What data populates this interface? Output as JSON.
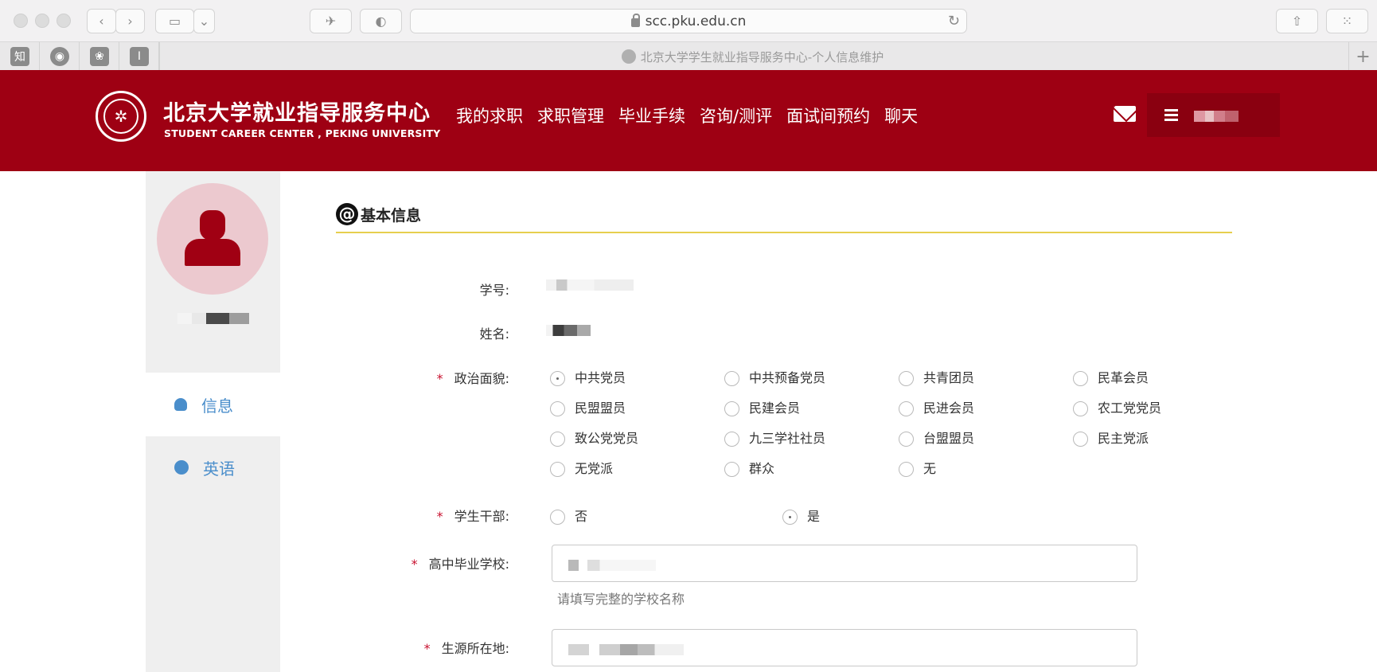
{
  "browser": {
    "url": "scc.pku.edu.cn",
    "tab_title": "北京大学学生就业指导服务中心-个人信息维护",
    "favorites": [
      {
        "label": "知",
        "icon": "zhihu-icon"
      },
      {
        "label": "",
        "icon": "location-pin-icon"
      },
      {
        "label": "",
        "icon": "paw-icon"
      },
      {
        "label": "I",
        "icon": "bookmark-icon"
      }
    ]
  },
  "header": {
    "logo_cn": "北京大学就业指导服务中心",
    "logo_en": "STUDENT CAREER CENTER , PEKING UNIVERSITY",
    "nav": [
      "我的求职",
      "求职管理",
      "毕业手续",
      "咨询/测评",
      "面试间预约",
      "聊天"
    ],
    "brand_color": "#9e0013"
  },
  "sidebar": {
    "items": [
      {
        "label": "信息",
        "icon": "user-icon"
      },
      {
        "label": "英语",
        "icon": "globe-icon"
      }
    ]
  },
  "form": {
    "section_title": "基本信息",
    "student_id_label": "学号:",
    "name_label": "姓名:",
    "political_label": "政治面貌:",
    "political_options": [
      "中共党员",
      "中共预备党员",
      "共青团员",
      "民革会员",
      "民盟盟员",
      "民建会员",
      "民进会员",
      "农工党党员",
      "致公党党员",
      "九三学社社员",
      "台盟盟员",
      "民主党派",
      "无党派",
      "群众",
      "无"
    ],
    "political_selected": "中共党员",
    "cadre_label": "学生干部:",
    "cadre_options": [
      "否",
      "是"
    ],
    "cadre_selected": "是",
    "high_school_label": "高中毕业学校:",
    "high_school_hint": "请填写完整的学校名称",
    "origin_label": "生源所在地:"
  }
}
